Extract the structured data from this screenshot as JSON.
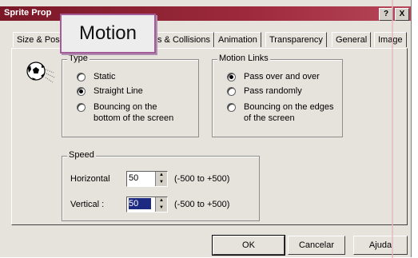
{
  "window": {
    "title": "Sprite Prop",
    "help_btn": "?",
    "close_btn": "X"
  },
  "callout": "Motion",
  "tabs": [
    {
      "label": "Size & Pos"
    },
    {
      "label": "s & Collisions"
    },
    {
      "label": "Animation"
    },
    {
      "label": "Transparency"
    },
    {
      "label": "General"
    },
    {
      "label": "Image"
    }
  ],
  "type_group": {
    "legend": "Type",
    "options": [
      {
        "label": "Static",
        "selected": false
      },
      {
        "label": "Straight Line",
        "selected": true
      },
      {
        "label": "Bouncing on the bottom of the screen",
        "selected": false
      }
    ]
  },
  "motion_links_group": {
    "legend": "Motion Links",
    "options": [
      {
        "label": "Pass over and over",
        "selected": true
      },
      {
        "label": "Pass randomly",
        "selected": false
      },
      {
        "label": "Bouncing on the edges of the screen",
        "selected": false
      }
    ]
  },
  "speed_group": {
    "legend": "Speed",
    "horizontal": {
      "label": "Horizontal",
      "value": "50",
      "range": "(-500 to +500)"
    },
    "vertical": {
      "label": "Vertical :",
      "value": "50",
      "range": "(-500 to +500)"
    }
  },
  "buttons": {
    "ok": "OK",
    "cancel": "Cancelar",
    "help": "Ajuda"
  },
  "icons": {
    "sprite": "soccer-ball-icon"
  }
}
